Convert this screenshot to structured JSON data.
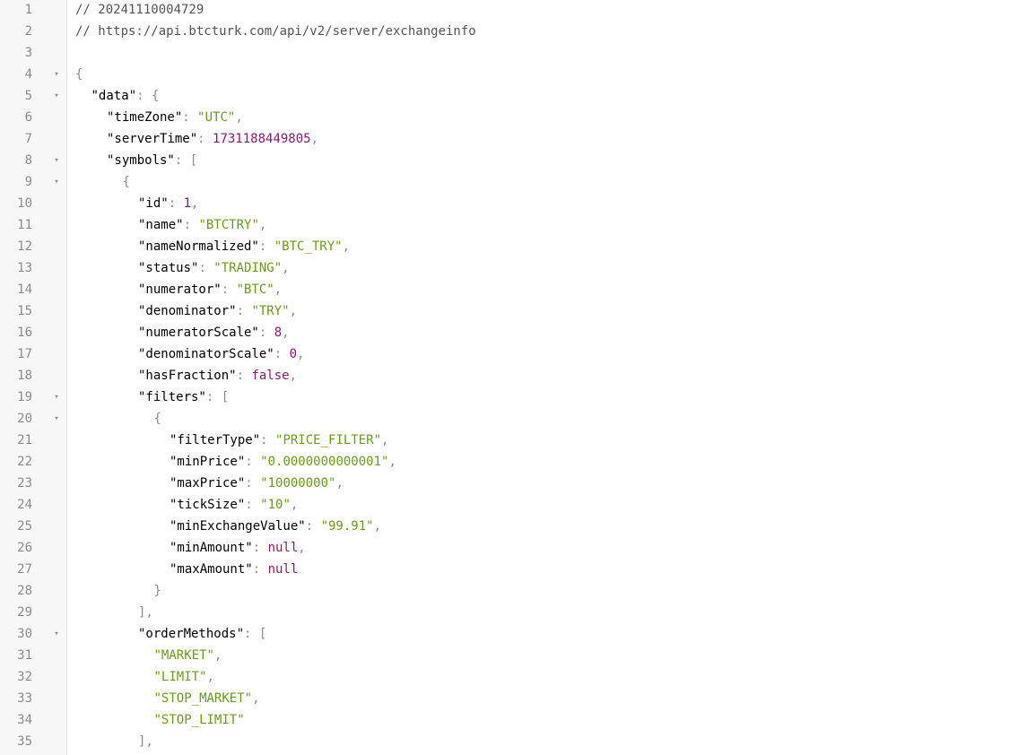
{
  "fold_glyph": "▾",
  "lines": [
    {
      "n": "1",
      "indent": 0,
      "fold": false,
      "tokens": [
        {
          "t": "// 20241110004729",
          "c": "cmt"
        }
      ]
    },
    {
      "n": "2",
      "indent": 0,
      "fold": false,
      "tokens": [
        {
          "t": "// https://api.btcturk.com/api/v2/server/exchangeinfo",
          "c": "cmt"
        }
      ]
    },
    {
      "n": "3",
      "indent": 0,
      "fold": false,
      "tokens": []
    },
    {
      "n": "4",
      "indent": 0,
      "fold": true,
      "tokens": [
        {
          "t": "{",
          "c": "pun"
        }
      ]
    },
    {
      "n": "5",
      "indent": 1,
      "fold": true,
      "tokens": [
        {
          "t": "\"data\"",
          "c": "key"
        },
        {
          "t": ": {",
          "c": "pun"
        }
      ]
    },
    {
      "n": "6",
      "indent": 2,
      "fold": false,
      "tokens": [
        {
          "t": "\"timeZone\"",
          "c": "key"
        },
        {
          "t": ": ",
          "c": "pun"
        },
        {
          "t": "\"UTC\"",
          "c": "str"
        },
        {
          "t": ",",
          "c": "pun"
        }
      ]
    },
    {
      "n": "7",
      "indent": 2,
      "fold": false,
      "tokens": [
        {
          "t": "\"serverTime\"",
          "c": "key"
        },
        {
          "t": ": ",
          "c": "pun"
        },
        {
          "t": "1731188449805",
          "c": "num"
        },
        {
          "t": ",",
          "c": "pun"
        }
      ]
    },
    {
      "n": "8",
      "indent": 2,
      "fold": true,
      "tokens": [
        {
          "t": "\"symbols\"",
          "c": "key"
        },
        {
          "t": ": [",
          "c": "pun"
        }
      ]
    },
    {
      "n": "9",
      "indent": 3,
      "fold": true,
      "tokens": [
        {
          "t": "{",
          "c": "pun"
        }
      ]
    },
    {
      "n": "10",
      "indent": 4,
      "fold": false,
      "tokens": [
        {
          "t": "\"id\"",
          "c": "key"
        },
        {
          "t": ": ",
          "c": "pun"
        },
        {
          "t": "1",
          "c": "num"
        },
        {
          "t": ",",
          "c": "pun"
        }
      ]
    },
    {
      "n": "11",
      "indent": 4,
      "fold": false,
      "tokens": [
        {
          "t": "\"name\"",
          "c": "key"
        },
        {
          "t": ": ",
          "c": "pun"
        },
        {
          "t": "\"BTCTRY\"",
          "c": "str"
        },
        {
          "t": ",",
          "c": "pun"
        }
      ]
    },
    {
      "n": "12",
      "indent": 4,
      "fold": false,
      "tokens": [
        {
          "t": "\"nameNormalized\"",
          "c": "key"
        },
        {
          "t": ": ",
          "c": "pun"
        },
        {
          "t": "\"BTC_TRY\"",
          "c": "str"
        },
        {
          "t": ",",
          "c": "pun"
        }
      ]
    },
    {
      "n": "13",
      "indent": 4,
      "fold": false,
      "tokens": [
        {
          "t": "\"status\"",
          "c": "key"
        },
        {
          "t": ": ",
          "c": "pun"
        },
        {
          "t": "\"TRADING\"",
          "c": "str"
        },
        {
          "t": ",",
          "c": "pun"
        }
      ]
    },
    {
      "n": "14",
      "indent": 4,
      "fold": false,
      "tokens": [
        {
          "t": "\"numerator\"",
          "c": "key"
        },
        {
          "t": ": ",
          "c": "pun"
        },
        {
          "t": "\"BTC\"",
          "c": "str"
        },
        {
          "t": ",",
          "c": "pun"
        }
      ]
    },
    {
      "n": "15",
      "indent": 4,
      "fold": false,
      "tokens": [
        {
          "t": "\"denominator\"",
          "c": "key"
        },
        {
          "t": ": ",
          "c": "pun"
        },
        {
          "t": "\"TRY\"",
          "c": "str"
        },
        {
          "t": ",",
          "c": "pun"
        }
      ]
    },
    {
      "n": "16",
      "indent": 4,
      "fold": false,
      "tokens": [
        {
          "t": "\"numeratorScale\"",
          "c": "key"
        },
        {
          "t": ": ",
          "c": "pun"
        },
        {
          "t": "8",
          "c": "num"
        },
        {
          "t": ",",
          "c": "pun"
        }
      ]
    },
    {
      "n": "17",
      "indent": 4,
      "fold": false,
      "tokens": [
        {
          "t": "\"denominatorScale\"",
          "c": "key"
        },
        {
          "t": ": ",
          "c": "pun"
        },
        {
          "t": "0",
          "c": "num"
        },
        {
          "t": ",",
          "c": "pun"
        }
      ]
    },
    {
      "n": "18",
      "indent": 4,
      "fold": false,
      "tokens": [
        {
          "t": "\"hasFraction\"",
          "c": "key"
        },
        {
          "t": ": ",
          "c": "pun"
        },
        {
          "t": "false",
          "c": "kw"
        },
        {
          "t": ",",
          "c": "pun"
        }
      ]
    },
    {
      "n": "19",
      "indent": 4,
      "fold": true,
      "tokens": [
        {
          "t": "\"filters\"",
          "c": "key"
        },
        {
          "t": ": [",
          "c": "pun"
        }
      ]
    },
    {
      "n": "20",
      "indent": 5,
      "fold": true,
      "tokens": [
        {
          "t": "{",
          "c": "pun"
        }
      ]
    },
    {
      "n": "21",
      "indent": 6,
      "fold": false,
      "tokens": [
        {
          "t": "\"filterType\"",
          "c": "key"
        },
        {
          "t": ": ",
          "c": "pun"
        },
        {
          "t": "\"PRICE_FILTER\"",
          "c": "str"
        },
        {
          "t": ",",
          "c": "pun"
        }
      ]
    },
    {
      "n": "22",
      "indent": 6,
      "fold": false,
      "tokens": [
        {
          "t": "\"minPrice\"",
          "c": "key"
        },
        {
          "t": ": ",
          "c": "pun"
        },
        {
          "t": "\"0.0000000000001\"",
          "c": "str"
        },
        {
          "t": ",",
          "c": "pun"
        }
      ]
    },
    {
      "n": "23",
      "indent": 6,
      "fold": false,
      "tokens": [
        {
          "t": "\"maxPrice\"",
          "c": "key"
        },
        {
          "t": ": ",
          "c": "pun"
        },
        {
          "t": "\"10000000\"",
          "c": "str"
        },
        {
          "t": ",",
          "c": "pun"
        }
      ]
    },
    {
      "n": "24",
      "indent": 6,
      "fold": false,
      "tokens": [
        {
          "t": "\"tickSize\"",
          "c": "key"
        },
        {
          "t": ": ",
          "c": "pun"
        },
        {
          "t": "\"10\"",
          "c": "str"
        },
        {
          "t": ",",
          "c": "pun"
        }
      ]
    },
    {
      "n": "25",
      "indent": 6,
      "fold": false,
      "tokens": [
        {
          "t": "\"minExchangeValue\"",
          "c": "key"
        },
        {
          "t": ": ",
          "c": "pun"
        },
        {
          "t": "\"99.91\"",
          "c": "str"
        },
        {
          "t": ",",
          "c": "pun"
        }
      ]
    },
    {
      "n": "26",
      "indent": 6,
      "fold": false,
      "tokens": [
        {
          "t": "\"minAmount\"",
          "c": "key"
        },
        {
          "t": ": ",
          "c": "pun"
        },
        {
          "t": "null",
          "c": "kw"
        },
        {
          "t": ",",
          "c": "pun"
        }
      ]
    },
    {
      "n": "27",
      "indent": 6,
      "fold": false,
      "tokens": [
        {
          "t": "\"maxAmount\"",
          "c": "key"
        },
        {
          "t": ": ",
          "c": "pun"
        },
        {
          "t": "null",
          "c": "kw"
        }
      ]
    },
    {
      "n": "28",
      "indent": 5,
      "fold": false,
      "tokens": [
        {
          "t": "}",
          "c": "pun"
        }
      ]
    },
    {
      "n": "29",
      "indent": 4,
      "fold": false,
      "tokens": [
        {
          "t": "],",
          "c": "pun"
        }
      ]
    },
    {
      "n": "30",
      "indent": 4,
      "fold": true,
      "tokens": [
        {
          "t": "\"orderMethods\"",
          "c": "key"
        },
        {
          "t": ": [",
          "c": "pun"
        }
      ]
    },
    {
      "n": "31",
      "indent": 5,
      "fold": false,
      "tokens": [
        {
          "t": "\"MARKET\"",
          "c": "str"
        },
        {
          "t": ",",
          "c": "pun"
        }
      ]
    },
    {
      "n": "32",
      "indent": 5,
      "fold": false,
      "tokens": [
        {
          "t": "\"LIMIT\"",
          "c": "str"
        },
        {
          "t": ",",
          "c": "pun"
        }
      ]
    },
    {
      "n": "33",
      "indent": 5,
      "fold": false,
      "tokens": [
        {
          "t": "\"STOP_MARKET\"",
          "c": "str"
        },
        {
          "t": ",",
          "c": "pun"
        }
      ]
    },
    {
      "n": "34",
      "indent": 5,
      "fold": false,
      "tokens": [
        {
          "t": "\"STOP_LIMIT\"",
          "c": "str"
        }
      ]
    },
    {
      "n": "35",
      "indent": 4,
      "fold": false,
      "tokens": [
        {
          "t": "],",
          "c": "pun"
        }
      ]
    }
  ]
}
